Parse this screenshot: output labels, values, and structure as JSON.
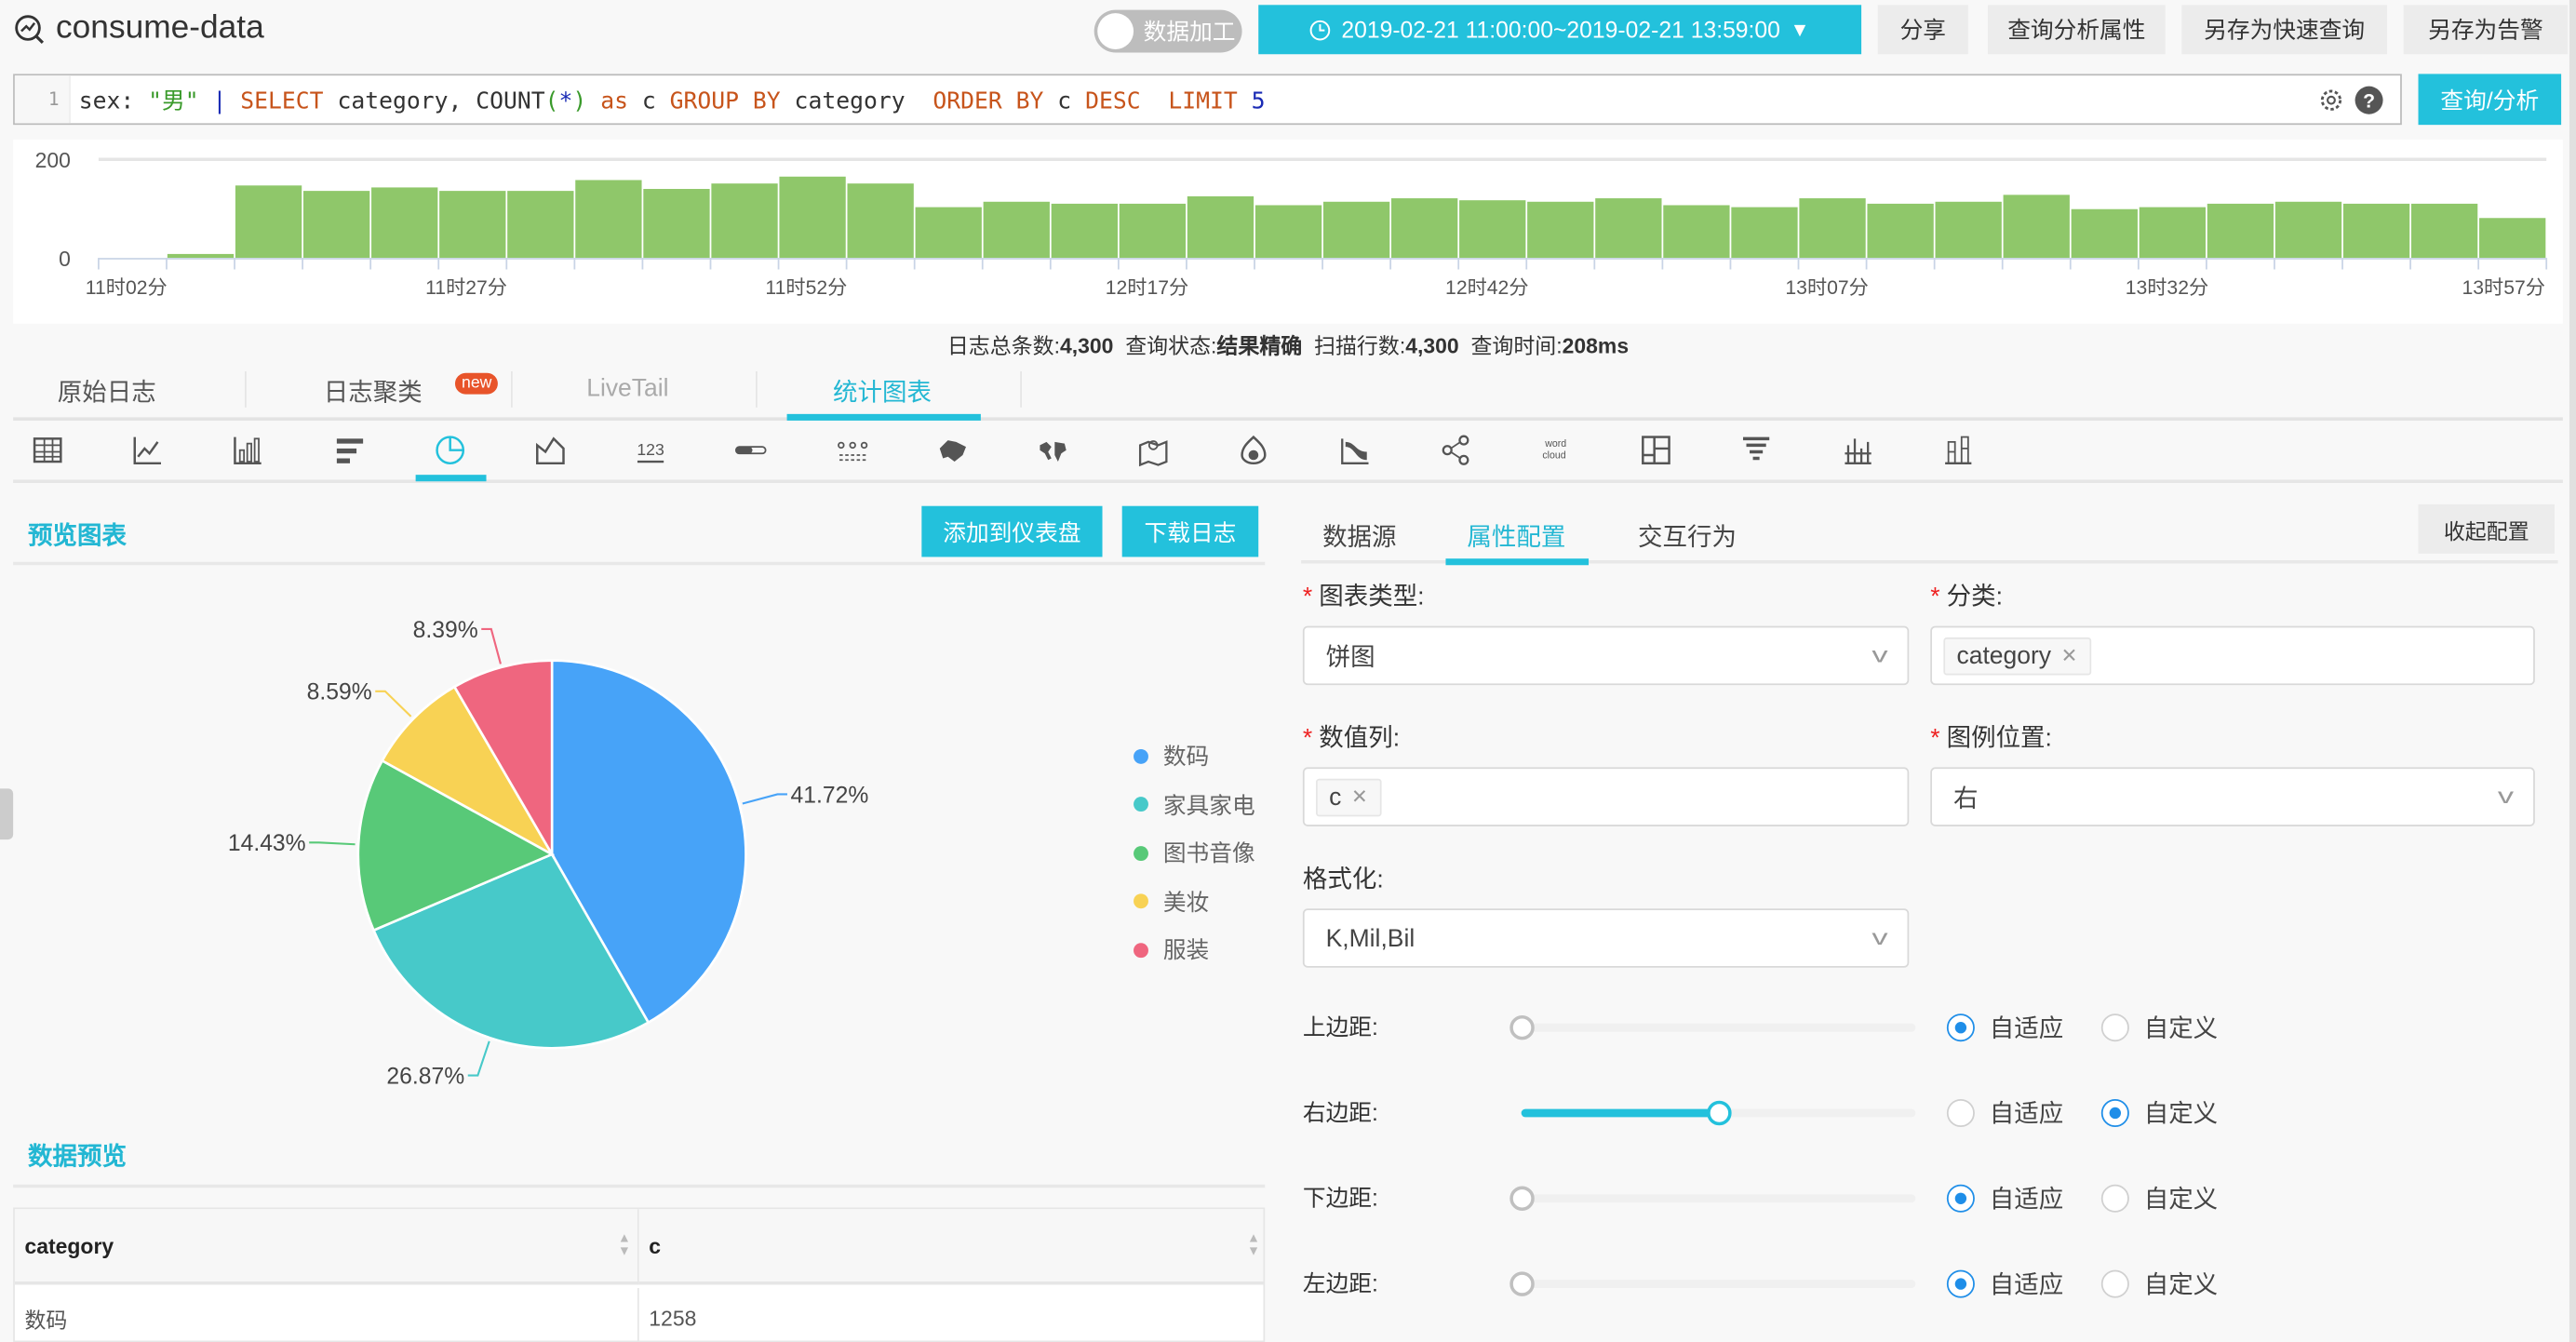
{
  "header": {
    "title": "consume-data",
    "toggle_label": "数据加工",
    "toggle_on": false,
    "time_range": "2019-02-21 11:00:00~2019-02-21 13:59:00",
    "buttons": [
      "分享",
      "查询分析属性",
      "另存为快速查询",
      "另存为告警"
    ]
  },
  "query": {
    "line_number": "1",
    "tokens": [
      {
        "t": "sex: ",
        "c": ""
      },
      {
        "t": "\"男\"",
        "c": "str"
      },
      {
        "t": " | ",
        "c": "pipe"
      },
      {
        "t": "SELECT",
        "c": "kw"
      },
      {
        "t": " category, COUNT",
        "c": ""
      },
      {
        "t": "(",
        "c": "paren"
      },
      {
        "t": "*",
        "c": "pipe"
      },
      {
        "t": ")",
        "c": "paren"
      },
      {
        "t": " ",
        "c": ""
      },
      {
        "t": "as",
        "c": "kw"
      },
      {
        "t": " c ",
        "c": ""
      },
      {
        "t": "GROUP BY",
        "c": "kw"
      },
      {
        "t": " category  ",
        "c": ""
      },
      {
        "t": "ORDER BY",
        "c": "kw"
      },
      {
        "t": " c ",
        "c": ""
      },
      {
        "t": "DESC",
        "c": "kw"
      },
      {
        "t": "  ",
        "c": ""
      },
      {
        "t": "LIMIT",
        "c": "kw"
      },
      {
        "t": " ",
        "c": ""
      },
      {
        "t": "5",
        "c": "num"
      }
    ],
    "submit_label": "查询/分析"
  },
  "stats": {
    "total_label": "日志总条数:",
    "total": "4,300",
    "status_label": "查询状态:",
    "status": "结果精确",
    "scanned_label": "扫描行数:",
    "scanned": "4,300",
    "time_label": "查询时间:",
    "time": "208ms"
  },
  "tabs": [
    {
      "label": "原始日志",
      "active": false
    },
    {
      "label": "日志聚类",
      "active": false,
      "badge": "new"
    },
    {
      "label": "LiveTail",
      "active": false,
      "disabled": true
    },
    {
      "label": "统计图表",
      "active": true
    }
  ],
  "chart_types": [
    "table-icon",
    "line-chart-icon",
    "column-chart-icon",
    "bar-chart-icon",
    "pie-chart-icon",
    "area-chart-icon",
    "single-value-icon",
    "progress-bar-icon",
    "flow-chart-icon",
    "china-map-icon",
    "world-map-icon",
    "geo-map-icon",
    "heatmap-icon",
    "sankey-icon",
    "graph-icon",
    "word-cloud-icon",
    "treemap-icon",
    "funnel-icon",
    "histogram-icon",
    "stacked-column-icon"
  ],
  "active_chart_type": 4,
  "preview": {
    "title": "预览图表",
    "add_dashboard": "添加到仪表盘",
    "download": "下载日志"
  },
  "data_preview": {
    "title": "数据预览",
    "columns": [
      "category",
      "c"
    ],
    "rows": [
      [
        "数码",
        "1258"
      ]
    ]
  },
  "config": {
    "tabs": [
      "数据源",
      "属性配置",
      "交互行为"
    ],
    "active_tab": 1,
    "collapse": "收起配置",
    "chart_type_label": "图表类型:",
    "chart_type_value": "饼图",
    "category_label": "分类:",
    "category_tag": "category",
    "value_label": "数值列:",
    "value_tag": "c",
    "legend_label": "图例位置:",
    "legend_value": "右",
    "format_label": "格式化:",
    "format_value": "K,Mil,Bil",
    "radio_auto": "自适应",
    "radio_custom": "自定义",
    "margins": [
      {
        "label": "上边距:",
        "value": 0,
        "mode": "auto"
      },
      {
        "label": "右边距:",
        "value": 0.5,
        "mode": "custom"
      },
      {
        "label": "下边距:",
        "value": 0,
        "mode": "auto"
      },
      {
        "label": "左边距:",
        "value": 0,
        "mode": "auto"
      }
    ]
  },
  "colors": {
    "accent": "#23c1dc",
    "bar": "#8fc76a"
  },
  "chart_data": [
    {
      "type": "bar",
      "yticks": [
        0,
        200
      ],
      "ylim": [
        0,
        200
      ],
      "xtick_labels": [
        "11时02分",
        "11时27分",
        "11时52分",
        "12时17分",
        "12时42分",
        "13时07分",
        "13时32分",
        "13时57分"
      ],
      "values": [
        0,
        8,
        147,
        136,
        143,
        136,
        136,
        158,
        140,
        151,
        165,
        151,
        103,
        114,
        110,
        110,
        125,
        107,
        114,
        121,
        117,
        114,
        121,
        107,
        103,
        121,
        110,
        114,
        128,
        99,
        103,
        110,
        114,
        110,
        110,
        81
      ]
    },
    {
      "type": "pie",
      "legend": "right",
      "slices": [
        {
          "label": "数码",
          "percent": 41.72,
          "display": "41.72%",
          "color": "#47a3f8"
        },
        {
          "label": "家具家电",
          "percent": 26.87,
          "display": "26.87%",
          "color": "#47c9c9"
        },
        {
          "label": "图书音像",
          "percent": 14.43,
          "display": "14.43%",
          "color": "#58c978"
        },
        {
          "label": "美妆",
          "percent": 8.59,
          "display": "8.59%",
          "color": "#f8d254"
        },
        {
          "label": "服装",
          "percent": 8.39,
          "display": "8.39%",
          "color": "#ef667f"
        }
      ]
    }
  ]
}
